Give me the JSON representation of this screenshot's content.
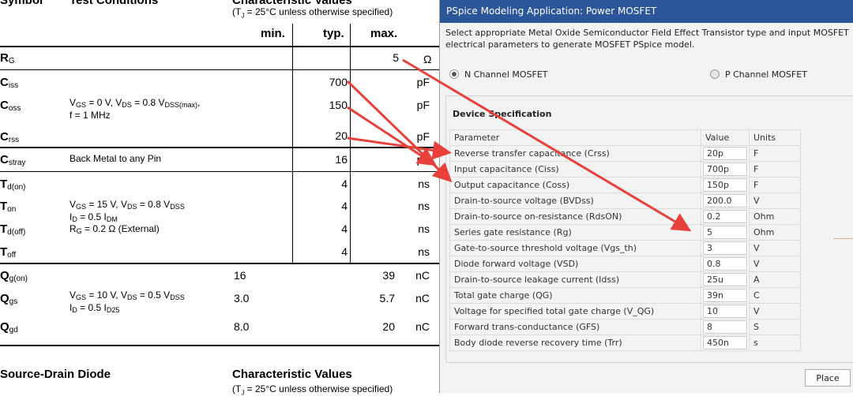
{
  "datasheet": {
    "header": {
      "symbol": "Symbol",
      "test_conditions": "Test Conditions",
      "char_values": "Characteristic Values",
      "condition_note": "(Tₗ = 25°C unless otherwise specified)"
    },
    "columns": {
      "min": "min.",
      "typ": "typ.",
      "max": "max."
    },
    "rows": [
      {
        "sym": "R",
        "sub": "G",
        "cond": "",
        "min": "",
        "typ": "",
        "max": "5",
        "unit": "Ω"
      },
      {
        "sym": "C",
        "sub": "iss",
        "cond": "",
        "min": "",
        "typ": "700",
        "max": "",
        "unit": "pF"
      },
      {
        "sym": "C",
        "sub": "oss",
        "cond1": "Vₗₛ = 0 V, Vₔₛ = 0.8 Vₔₛₛ₍max₎,",
        "cond2": "f = 1 MHz",
        "min": "",
        "typ": "150",
        "max": "",
        "unit": "pF"
      },
      {
        "sym": "C",
        "sub": "rss",
        "cond": "",
        "min": "",
        "typ": "20",
        "max": "",
        "unit": "pF"
      },
      {
        "sym": "C",
        "sub": "stray",
        "cond": "Back Metal to any Pin",
        "min": "",
        "typ": "16",
        "max": "",
        "unit": "pF"
      },
      {
        "sym": "T",
        "sub": "d(on)",
        "cond": "",
        "min": "",
        "typ": "4",
        "max": "",
        "unit": "ns"
      },
      {
        "sym": "T",
        "sub": "on",
        "cond1": "V_GS = 15 V, V_DS = 0.8 V_DSS",
        "cond2": "I_D = 0.5 I_DM",
        "min": "",
        "typ": "4",
        "max": "",
        "unit": "ns"
      },
      {
        "sym": "T",
        "sub": "d(off)",
        "cond": "R_G = 0.2 Ω (External)",
        "min": "",
        "typ": "4",
        "max": "",
        "unit": "ns"
      },
      {
        "sym": "T",
        "sub": "off",
        "cond": "",
        "min": "",
        "typ": "4",
        "max": "",
        "unit": "ns"
      },
      {
        "sym": "Q",
        "sub": "g(on)",
        "cond": "",
        "min": "16",
        "typ": "",
        "max": "39",
        "unit": "nC"
      },
      {
        "sym": "Q",
        "sub": "gs",
        "cond1": "V_GS = 10 V, V_DS = 0.5 V_DSS",
        "cond2": "I_D = 0.5 I_D25",
        "min": "3.0",
        "typ": "",
        "max": "5.7",
        "unit": "nC"
      },
      {
        "sym": "Q",
        "sub": "gd",
        "cond": "",
        "min": "8.0",
        "typ": "",
        "max": "20",
        "unit": "nC"
      }
    ],
    "section2": {
      "title": "Source-Drain Diode",
      "char_values": "Characteristic Values",
      "condition_note": "(Tₗ = 25°C unless otherwise specified)"
    }
  },
  "dialog": {
    "title": "PSpice Modeling Application: Power MOSFET",
    "description": "Select appropriate Metal Oxide Semiconductor Field Effect Transistor type and input MOSFET electrical parameters to generate MOSFET PSpice model.",
    "radio_n": "N Channel MOSFET",
    "radio_p": "P Channel MOSFET",
    "spec_title": "Device Specification",
    "table_headers": {
      "param": "Parameter",
      "value": "Value",
      "units": "Units"
    },
    "params": [
      {
        "name": "Reverse transfer capacitance (Crss)",
        "value": "20p",
        "unit": "F"
      },
      {
        "name": "Input capacitance (Ciss)",
        "value": "700p",
        "unit": "F"
      },
      {
        "name": "Output capacitance (Coss)",
        "value": "150p",
        "unit": "F"
      },
      {
        "name": "Drain-to-source voltage (BVDss)",
        "value": "200.0",
        "unit": "V"
      },
      {
        "name": "Drain-to-source on-resistance (RdsON)",
        "value": "0.2",
        "unit": "Ohm"
      },
      {
        "name": "Series gate resistance (Rg)",
        "value": "5",
        "unit": "Ohm"
      },
      {
        "name": "Gate-to-source threshold voltage (Vgs_th)",
        "value": "3",
        "unit": "V"
      },
      {
        "name": "Diode forward voltage (VSD)",
        "value": "0.8",
        "unit": "V"
      },
      {
        "name": "Drain-to-source leakage current (Idss)",
        "value": "25u",
        "unit": "A"
      },
      {
        "name": "Total gate charge (QG)",
        "value": "39n",
        "unit": "C"
      },
      {
        "name": "Voltage for specified total gate charge (V_QG)",
        "value": "10",
        "unit": "V"
      },
      {
        "name": "Forward trans-conductance (GFS)",
        "value": "8",
        "unit": "S"
      },
      {
        "name": "Body diode reverse recovery time (Trr)",
        "value": "450n",
        "unit": "s"
      }
    ],
    "place_button": "Place"
  },
  "colors": {
    "titlebar": "#2b579a",
    "arrow": "#e8413c"
  }
}
